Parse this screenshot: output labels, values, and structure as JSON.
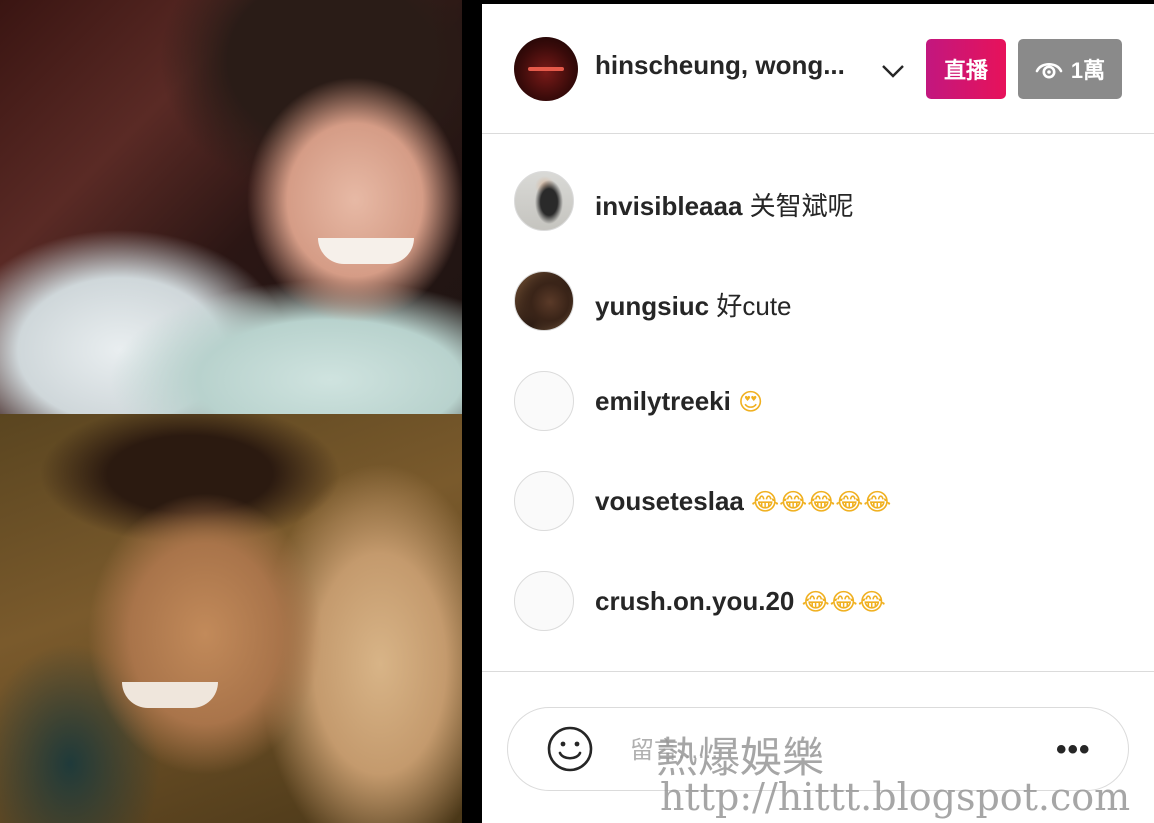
{
  "header": {
    "host_name": "hinscheung, wong...",
    "live_label": "直播",
    "viewer_count": "1萬"
  },
  "comments": [
    {
      "username": "invisibleaaa",
      "text": "关智斌呢"
    },
    {
      "username": "yungsiuc",
      "text": "好cute"
    },
    {
      "username": "emilytreeki",
      "text": "😍"
    },
    {
      "username": "vouseteslaa",
      "text": "😂😂😂😂😂"
    },
    {
      "username": "crush.on.you.20",
      "text": "😂😂😂"
    }
  ],
  "composer": {
    "placeholder": "留言......",
    "more_label": "•••"
  },
  "watermark": {
    "title": "熱爆娛樂",
    "url": "http://hittt.blogspot.com"
  },
  "colors": {
    "live_gradient_start": "#c2177f",
    "live_gradient_end": "#e7125a",
    "viewer_badge": "#8a8a8a",
    "text": "#262626",
    "divider": "#dbdbdb"
  }
}
